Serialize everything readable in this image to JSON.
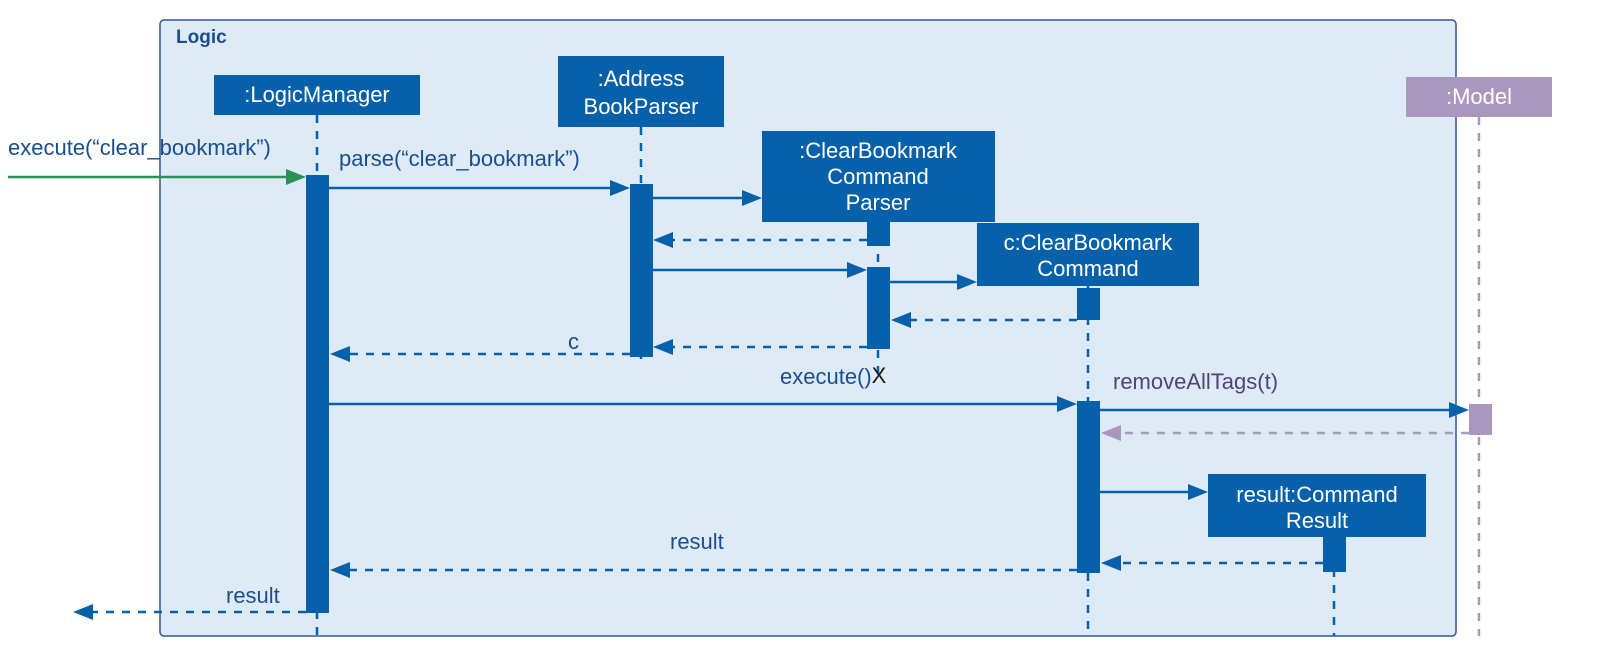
{
  "frame": {
    "label": "Logic"
  },
  "participants": {
    "logicManager": ":LogicManager",
    "addressBookParser_l1": ":Address",
    "addressBookParser_l2": "BookParser",
    "clearBookmarkCommandParser_l1": ":ClearBookmark",
    "clearBookmarkCommandParser_l2": "Command",
    "clearBookmarkCommandParser_l3": "Parser",
    "clearBookmarkCommand_l1": "c:ClearBookmark",
    "clearBookmarkCommand_l2": "Command",
    "commandResult_l1": "result:Command",
    "commandResult_l2": "Result",
    "model": ":Model"
  },
  "messages": {
    "executeClearBookmark": "execute(“clear_bookmark”)",
    "parseClearBookmark": "parse(“clear_bookmark”)",
    "c": "c",
    "execute": "execute()",
    "removeAllTags": "removeAllTags(t)",
    "result1": "result",
    "result2": "result"
  },
  "marks": {
    "destroy": "X"
  }
}
